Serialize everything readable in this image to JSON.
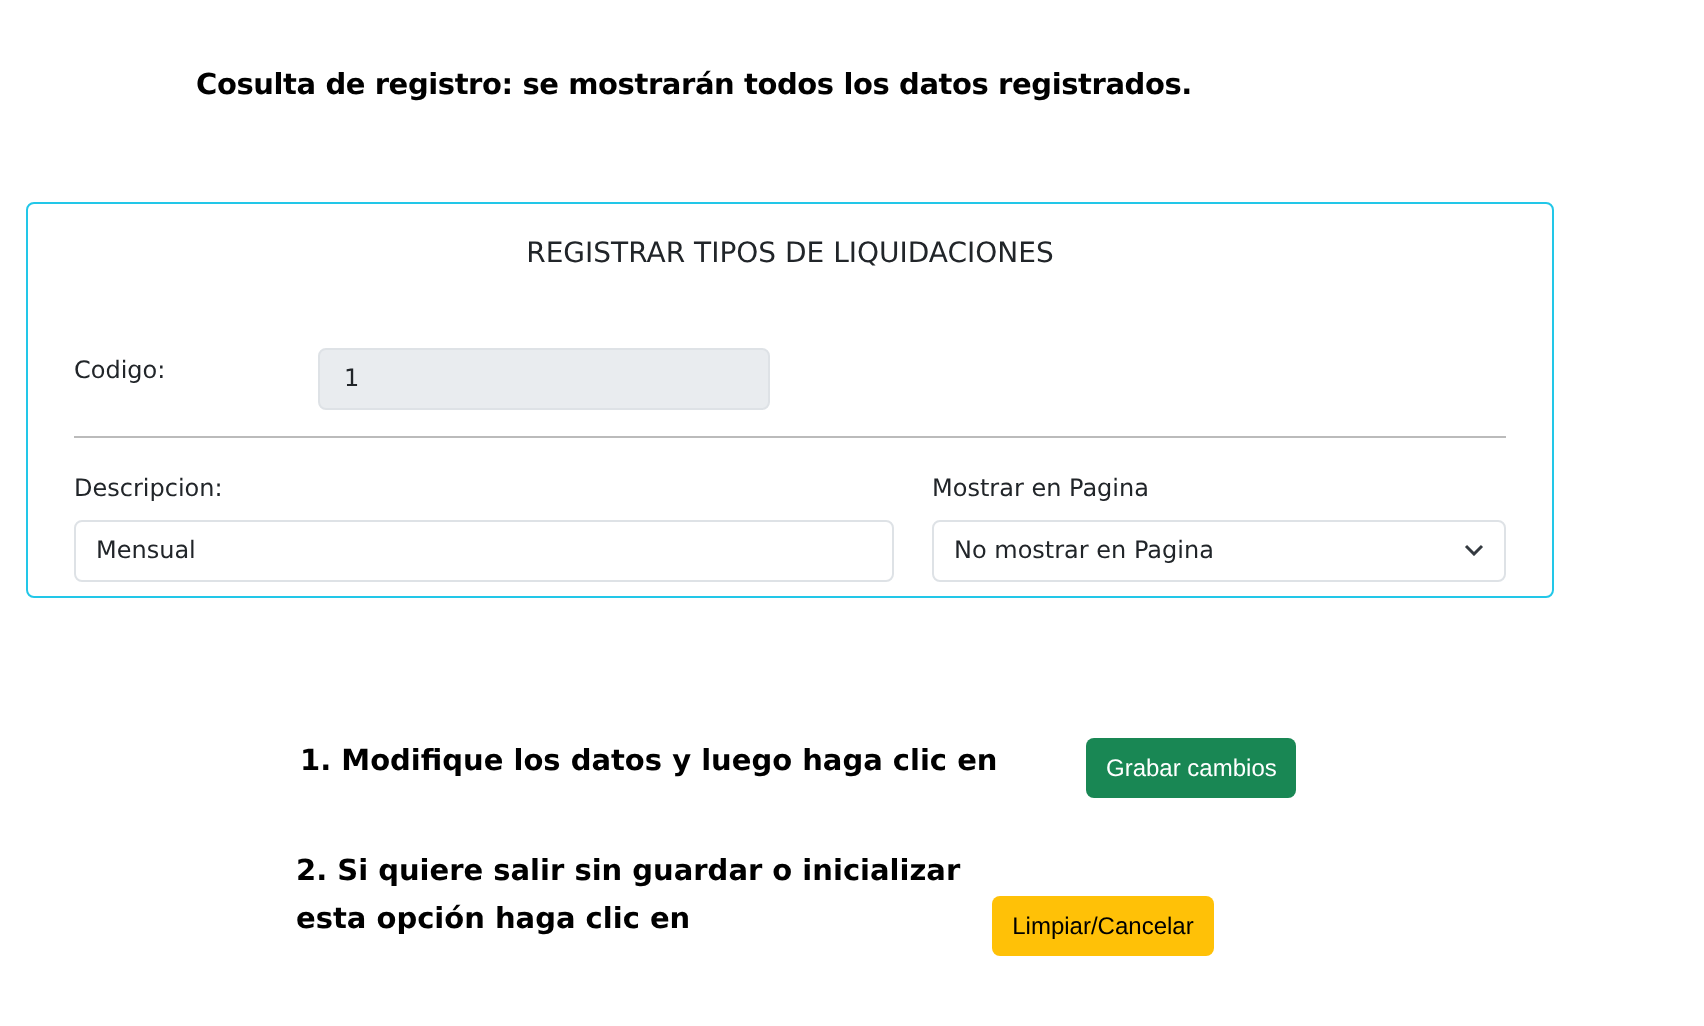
{
  "heading": "Cosulta de registro: se mostrarán todos los datos registrados.",
  "form": {
    "title": "REGISTRAR TIPOS DE LIQUIDACIONES",
    "codigo": {
      "label": "Codigo:",
      "value": "1",
      "disabled": true
    },
    "descripcion": {
      "label": "Descripcion:",
      "value": "Mensual"
    },
    "mostrar": {
      "label": "Mostrar en Pagina",
      "value": "No mostrar en Pagina"
    }
  },
  "steps": [
    {
      "lines": [
        "1. Modifique  los datos y luego haga clic en"
      ],
      "button": {
        "label": "Grabar cambios",
        "kind": "success"
      }
    },
    {
      "lines": [
        "2.  Si quiere salir sin guardar o inicializar",
        "esta opción haga clic en"
      ],
      "button": {
        "label": "Limpiar/Cancelar",
        "kind": "warning"
      }
    }
  ]
}
